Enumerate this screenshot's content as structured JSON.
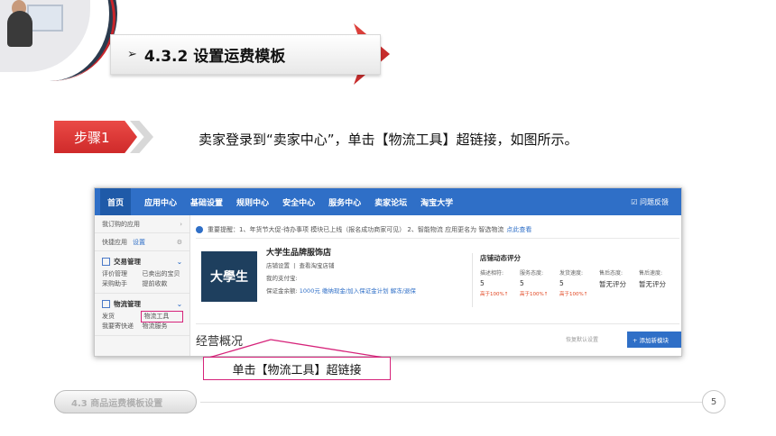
{
  "slide": {
    "title_arrow": "➢",
    "title": "4.3.2  设置运费模板",
    "step_label": "步骤1",
    "instruction": "卖家登录到“卖家中心”，单击【物流工具】超链接，如图所示。",
    "callout": "单击【物流工具】超链接",
    "footer_section": "4.3  商品运费模板设置",
    "page_number": "5",
    "accent_color": "#d4262b",
    "callout_color": "#d6237a"
  },
  "screenshot": {
    "nav": {
      "items": [
        "首页",
        "应用中心",
        "基础设置",
        "规则中心",
        "安全中心",
        "服务中心",
        "卖家论坛",
        "淘宝大学"
      ],
      "help": "问题反馈",
      "bar_color": "#2f6fc7"
    },
    "sidebar": {
      "my_apps": "我订购的应用",
      "quick_apps": "快捷应用",
      "settings_link": "设置",
      "trade_group": {
        "title": "交易管理",
        "items": [
          "评价管理",
          "已卖出的宝贝",
          "采购助手",
          "提前收款"
        ]
      },
      "logistics_group": {
        "title": "物流管理",
        "items": [
          "发货",
          "物流工具",
          "我要寄快递",
          "物流服务"
        ]
      }
    },
    "notice": {
      "text": "重要提醒：1、年货节大促-待办事项 模块已上线（报名成功商家可见） 2、智能物流 应用更名为 智选物流",
      "link": "点此查看"
    },
    "store": {
      "logo_text": "大學生",
      "name": "大学生品牌服饰店",
      "line1_label": "店铺设置",
      "line1_link": "查看淘宝店铺",
      "line2_label": "我的支付宝:",
      "line3_label": "保证金余额:",
      "line3_amount": "1000元",
      "line3_links": "缴纳现金/加入保证金计划",
      "line3_extra": "解冻/退保"
    },
    "ratings": {
      "title": "店铺动态评分",
      "columns": [
        {
          "header": "描述相符:",
          "value": "5",
          "change": "高于100%↑"
        },
        {
          "header": "服务态度:",
          "value": "5",
          "change": "高于100%↑"
        },
        {
          "header": "发货速度:",
          "value": "5",
          "change": "高于100%↑"
        },
        {
          "header": "售后态度:",
          "value": "暂无评分",
          "change": ""
        },
        {
          "header": "售后速度:",
          "value": "暂无评分",
          "change": ""
        }
      ]
    },
    "overview": {
      "title": "经营概况",
      "reset": "恢复默认设置",
      "add_button": "+ 添加新模块"
    }
  }
}
